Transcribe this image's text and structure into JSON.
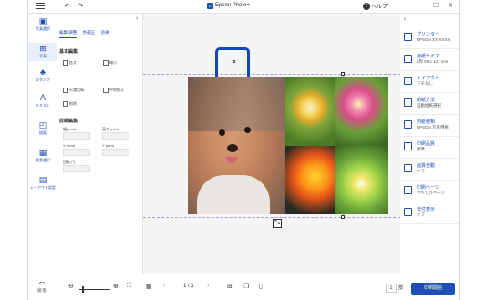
{
  "app": {
    "title": "Epson Photo+",
    "logo": "E",
    "help": "ヘルプ",
    "accent": "#1f4fb2"
  },
  "rail": {
    "items": [
      {
        "label": "写真選択",
        "icon": "photo-select-icon"
      },
      {
        "label": "写真",
        "icon": "add-photo-icon"
      },
      {
        "label": "スタンプ",
        "icon": "stamp-icon"
      },
      {
        "label": "テキスト",
        "icon": "text-icon"
      },
      {
        "label": "描画",
        "icon": "shapes-icon"
      },
      {
        "label": "背景選択",
        "icon": "background-icon"
      },
      {
        "label": "レイアウト設定",
        "icon": "layout-icon"
      }
    ]
  },
  "panel": {
    "tabs": [
      "編集/調整",
      "色補正",
      "効果"
    ],
    "basic_title": "基本編集",
    "tools": [
      "拡大",
      "縮小",
      "90度回転",
      "中央揃え",
      "削除"
    ],
    "detail_title": "詳細編集",
    "fields": [
      "幅 (mm)",
      "高さ (mm)",
      "X (mm)",
      "Y (mm)",
      "回転 (°)"
    ]
  },
  "settings": {
    "rows": [
      {
        "label": "プリンター",
        "value": "EPSON XX-XXXX"
      },
      {
        "label": "用紙サイズ",
        "value": "L判 89 x 127 mm"
      },
      {
        "label": "レイアウト",
        "value": "フチなし"
      },
      {
        "label": "給紙方法",
        "value": "自動給紙選択"
      },
      {
        "label": "用紙種類",
        "value": "EPSON 写真用紙"
      },
      {
        "label": "印刷品質",
        "value": "標準"
      },
      {
        "label": "画質自動",
        "value": "オフ"
      },
      {
        "label": "印刷ページ",
        "value": "すべてのページ"
      },
      {
        "label": "日付表示",
        "value": "オフ"
      }
    ]
  },
  "bottom": {
    "back": "戻る",
    "page_current": "1",
    "page_sep": "/",
    "page_total": "1",
    "copies": "1",
    "copies_unit": "部",
    "print": "印刷開始"
  }
}
